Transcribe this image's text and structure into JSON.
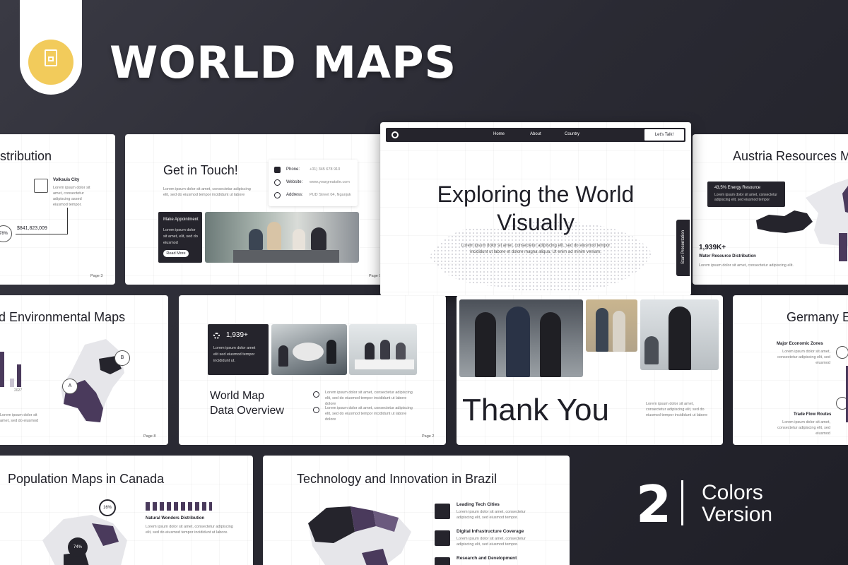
{
  "header": {
    "title": "WORLD MAPS",
    "badge_icon": "slides-doc-icon"
  },
  "footer": {
    "number": "2",
    "line1": "Colors",
    "line2": "Version"
  },
  "slides": {
    "distribution": {
      "title": "stribution",
      "city": "Volksuis City",
      "desc": "Lorem ipsum dolor sit amet, consectetur adipiscing assed eiusmod tempor.",
      "value": "$841,823,009",
      "percent": "78%",
      "page": "Page 3"
    },
    "contact": {
      "title": "Get in Touch!",
      "desc": "Lorem ipsum dolor sit amet, consectetur adipiscing elit, sed do eiusmod tempor incididunt ut labore",
      "phone_label": "Phone:",
      "phone": "+01) 345 678 910",
      "website_label": "Website:",
      "website": "www.yourgreatsite.com",
      "address_label": "Address:",
      "address": "PUD Street 04, Nganjuk",
      "card_title": "Make Appointment",
      "card_text": "Lorem ipsum dolor sit amet, elit, sed do eiusmod",
      "card_btn": "Read More",
      "page": "Page 9"
    },
    "hero": {
      "nav": [
        "Home",
        "About",
        "Country"
      ],
      "cta": "Let's Talk!",
      "title1": "Exploring the World",
      "title2": "Visually",
      "desc1": "Lorem ipsum dolor sit amet, consectetur adipiscing elit, sed do eiusmod tempor",
      "desc2": "incididunt ut labore et dolore magna aliqua. Ut enim ad minim veniam.",
      "side": "Start Presentation"
    },
    "austria": {
      "title": "Austria Resources M",
      "tooltip_title": "43,5% Energy Resource",
      "tooltip_text": "Lorem ipsum dolor sit amet, consectetur adipiscing elit, sed eiusmod tempor",
      "stat": "1,939K+",
      "stat_label": "Water Resource Distribution",
      "stat_desc": "Lorem ipsum dolor sit amet, consectetur adipiscing elit."
    },
    "environment": {
      "title": "d Environmental Maps",
      "year": "2027",
      "label_a": "A",
      "label_b": "B",
      "desc": "Lorem ipsum dolor sit amet, sed do eiusmod",
      "page": "Page 8"
    },
    "overview": {
      "stat": "1,939+",
      "stat_desc": "Lorem ipsum dolor amet elit sed eiusmod tempor incididunt ut.",
      "title1": "World Map",
      "title2": "Data Overview",
      "item1": "Lorem ipsum dolor sit amet, consectetur adipiscing elit, sed do eiusmod tempor incididunt ut labore dolore",
      "item2": "Lorem ipsum dolor sit amet, consectetur adipiscing elit, sed do eiusmod tempor incididunt ut labore dolore",
      "page": "Page 2"
    },
    "thanks": {
      "title": "Thank You",
      "desc": "Lorem ipsum dolor sit amet, consectetur adipiscing elit, sed do eiusmod tempor incididunt ut labore"
    },
    "germany": {
      "title": "Germany E",
      "zone": "Major Economic Zones",
      "zone_desc": "Lorem ipsum dolor sit amet, consectetur adipiscing elit, sed eiusmod",
      "routes": "Trade Flow Routes",
      "routes_desc": "Lorem ipsum dolor sit amet, consectetur adipiscing elit, sed eiusmod"
    },
    "canada": {
      "title": "Population Maps in Canada",
      "pct1": "16%",
      "pct2": "74%",
      "label": "Natural Wonders Distribution",
      "desc": "Lorem ipsum dolor sit amet, consectetur adipiscing elit, sed do eiusmod tempor incididunt ut labore."
    },
    "brazil": {
      "title": "Technology and Innovation in Brazil",
      "item1": "Leading Tech Cities",
      "item1_desc": "Lorem ipsum dolor sit amet, consectetur adipiscing elit, sed eiusmod tempor.",
      "item2": "Digital Infrastructure Coverage",
      "item2_desc": "Lorem ipsum dolor sit amet, consectetur adipiscing elit, sed eiusmod tempor.",
      "item3": "Research and Development"
    }
  },
  "colors": {
    "accent": "#f2cb5b",
    "dark": "#25242c",
    "purple": "#4a3a5c"
  }
}
